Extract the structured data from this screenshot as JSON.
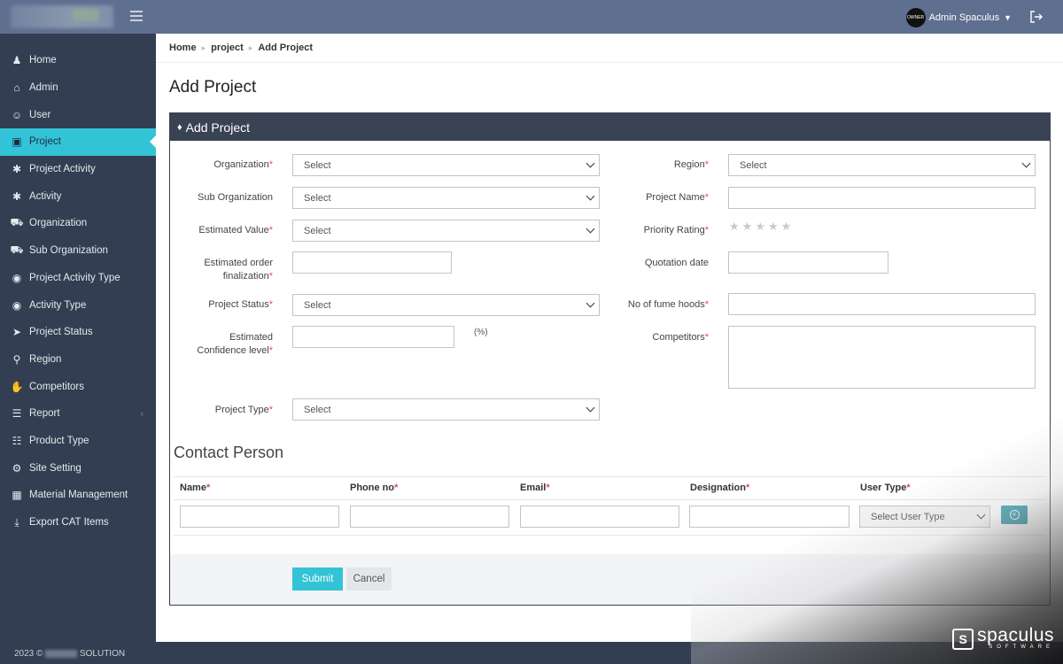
{
  "topbar": {
    "user_name": "Admin Spaculus",
    "avatar_text": "OWNER"
  },
  "sidebar": {
    "items": [
      {
        "label": "Home",
        "icon": "users-icon"
      },
      {
        "label": "Admin",
        "icon": "home-icon"
      },
      {
        "label": "User",
        "icon": "user-icon"
      },
      {
        "label": "Project",
        "icon": "laptop-icon",
        "active": true
      },
      {
        "label": "Project Activity",
        "icon": "asterisk-icon"
      },
      {
        "label": "Activity",
        "icon": "asterisk-icon"
      },
      {
        "label": "Organization",
        "icon": "bank-icon"
      },
      {
        "label": "Sub Organization",
        "icon": "bank-icon"
      },
      {
        "label": "Project Activity Type",
        "icon": "target-icon"
      },
      {
        "label": "Activity Type",
        "icon": "target-icon"
      },
      {
        "label": "Project Status",
        "icon": "plane-icon"
      },
      {
        "label": "Region",
        "icon": "map-pin-icon"
      },
      {
        "label": "Competitors",
        "icon": "hand-icon"
      },
      {
        "label": "Report",
        "icon": "list-icon"
      },
      {
        "label": "Product Type",
        "icon": "list-alt-icon"
      },
      {
        "label": "Site Setting",
        "icon": "gear-icon"
      },
      {
        "label": "Material Management",
        "icon": "cubes-icon"
      },
      {
        "label": "Export CAT Items",
        "icon": "download-icon"
      }
    ],
    "footer_year": "2023 ©",
    "footer_suffix": "SOLUTION"
  },
  "breadcrumb": {
    "home": "Home",
    "project": "project",
    "current": "Add Project"
  },
  "page_title": "Add Project",
  "panel_title": "Add Project",
  "form": {
    "organization_label": "Organization",
    "organization_value": "Select",
    "sub_organization_label": "Sub Organization",
    "sub_organization_value": "Select",
    "estimated_value_label": "Estimated Value",
    "estimated_value_value": "Select",
    "estimated_order_label_1": "Estimated order",
    "estimated_order_label_2": "finalization",
    "project_status_label": "Project Status",
    "project_status_value": "Select",
    "confidence_label_1": "Estimated",
    "confidence_label_2": "Confidence level",
    "percent_unit": "(%)",
    "project_type_label": "Project Type",
    "project_type_value": "Select",
    "region_label": "Region",
    "region_value": "Select",
    "project_name_label": "Project Name",
    "priority_rating_label": "Priority Rating",
    "priority_rating": 0,
    "quotation_date_label": "Quotation date",
    "fume_hoods_label": "No of fume hoods",
    "competitors_label": "Competitors",
    "required_mark": "*"
  },
  "contact": {
    "title": "Contact Person",
    "headers": [
      "Name",
      "Phone no",
      "Email",
      "Designation",
      "User Type"
    ],
    "user_type_placeholder": "Select User Type"
  },
  "buttons": {
    "submit": "Submit",
    "cancel": "Cancel"
  },
  "watermark": {
    "name": "spaculus",
    "sub": "SOFTWARE"
  },
  "colors": {
    "accent": "#33c3d6",
    "sidebar": "#333e52",
    "topbar": "#5f6f8f",
    "required": "#d9534f"
  }
}
